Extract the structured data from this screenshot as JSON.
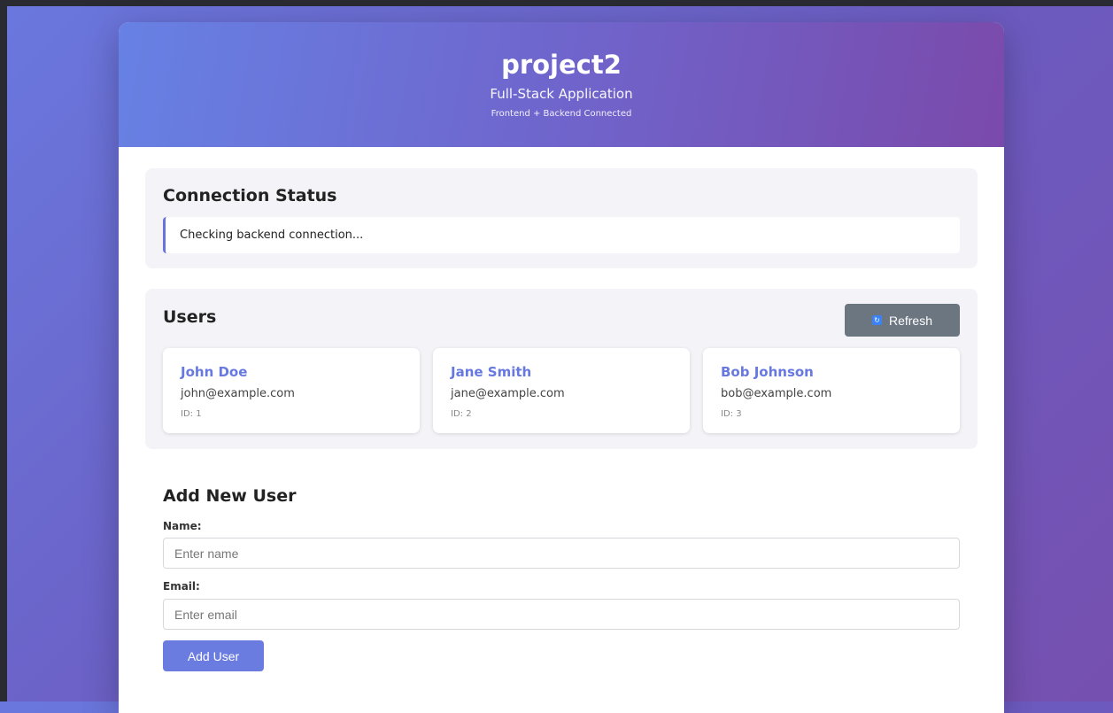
{
  "header": {
    "title": "project2",
    "subtitle": "Full-Stack Application",
    "tagline": "Frontend + Backend Connected"
  },
  "status": {
    "heading": "Connection Status",
    "message": "Checking backend connection..."
  },
  "users": {
    "heading": "Users",
    "refresh_label": "Refresh",
    "refresh_icon": "refresh-icon",
    "list": [
      {
        "name": "John Doe",
        "email": "john@example.com",
        "id": "ID: 1"
      },
      {
        "name": "Jane Smith",
        "email": "jane@example.com",
        "id": "ID: 2"
      },
      {
        "name": "Bob Johnson",
        "email": "bob@example.com",
        "id": "ID: 3"
      }
    ]
  },
  "form": {
    "heading": "Add New User",
    "name_label": "Name:",
    "name_placeholder": "Enter name",
    "email_label": "Email:",
    "email_placeholder": "Enter email",
    "submit_label": "Add User"
  },
  "colors": {
    "accent": "#6779e0",
    "header_start": "#6781e4",
    "header_end": "#7a4aab",
    "refresh_button": "#6c7680"
  }
}
